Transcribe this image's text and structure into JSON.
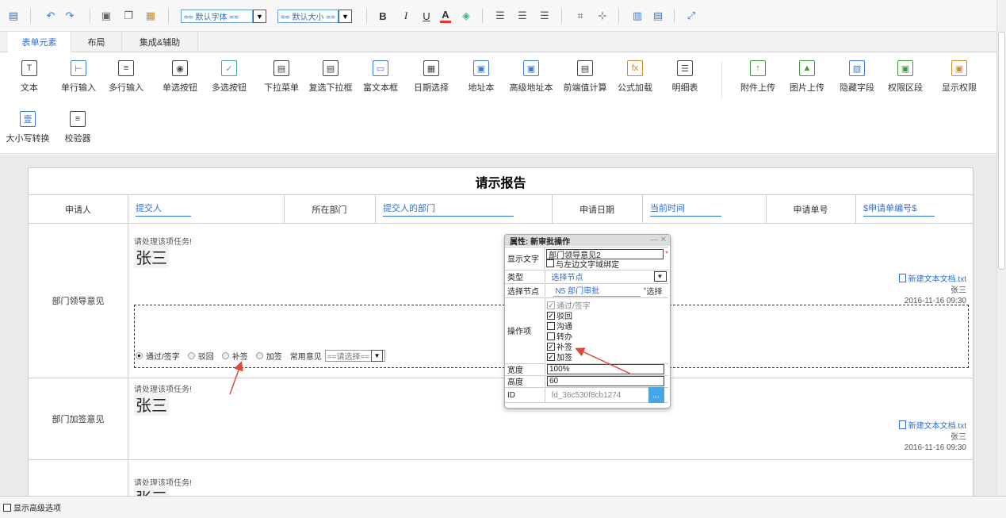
{
  "toolbar": {
    "font_select": "== 默认字体 ==",
    "size_select": "== 默认大小 ==",
    "bold": "B",
    "italic": "I",
    "underline": "U",
    "fontcolor": "A"
  },
  "tabs": [
    "表单元素",
    "布局",
    "集成&辅助"
  ],
  "ribbon": [
    "文本",
    "单行输入",
    "多行输入",
    "单选按钮",
    "多选按钮",
    "下拉菜单",
    "复选下拉框",
    "富文本框",
    "日期选择",
    "地址本",
    "高级地址本",
    "前端值计算",
    "公式加载",
    "明细表",
    "附件上传",
    "图片上传",
    "隐藏字段",
    "权限区段",
    "显示权限",
    "大小写转换",
    "校验器"
  ],
  "form": {
    "title": "请示报告",
    "header": [
      {
        "label": "申请人",
        "value": "提交人"
      },
      {
        "label": "所在部门",
        "value": "提交人的部门"
      },
      {
        "label": "申请日期",
        "value": "当前时间"
      },
      {
        "label": "申请单号",
        "value": "$申请单编号$"
      }
    ],
    "rows": [
      {
        "label": "部门领导意见",
        "task": "请处理该项任务!",
        "signature": "张三",
        "attachment": "新建文本文档.txt",
        "user": "张三",
        "time": "2016-11-16 09:30"
      },
      {
        "label": "部门加签意见",
        "task": "请处理该项任务!",
        "signature": "张三",
        "attachment": "新建文本文档.txt",
        "user": "张三",
        "time": "2016-11-16 09:30"
      },
      {
        "label": "",
        "task": "请处理该项任务!",
        "signature": "张三"
      }
    ],
    "options": [
      "通过/签字",
      "驳回",
      "补签",
      "加签"
    ],
    "common_label": "常用意见",
    "common_select": "==请选择=="
  },
  "popup": {
    "title": "属性: 新审批操作",
    "display_label": "显示文字",
    "display_value": "部门领导意见2",
    "bind_text": "与左边文字域绑定",
    "type_label": "类型",
    "type_value": "选择节点",
    "node_label": "选择节点",
    "node_value": "N5 部门审批",
    "node_choose": "选择",
    "ops_label": "操作项",
    "ops": [
      {
        "label": "通过/签字",
        "state": "disabled"
      },
      {
        "label": "驳回",
        "state": "on"
      },
      {
        "label": "沟通",
        "state": "off"
      },
      {
        "label": "转办",
        "state": "off"
      },
      {
        "label": "补签",
        "state": "on"
      },
      {
        "label": "加签",
        "state": "on"
      }
    ],
    "width_label": "宽度",
    "width_value": "100%",
    "height_label": "高度",
    "height_value": "60",
    "id_label": "ID",
    "id_value": "fd_36c530f8cb1274",
    "id_btn": "..."
  },
  "footer": {
    "advanced": "显示高级选项"
  },
  "colors": {
    "accent": "#2f6fd3",
    "arrow": "#e0473c"
  }
}
